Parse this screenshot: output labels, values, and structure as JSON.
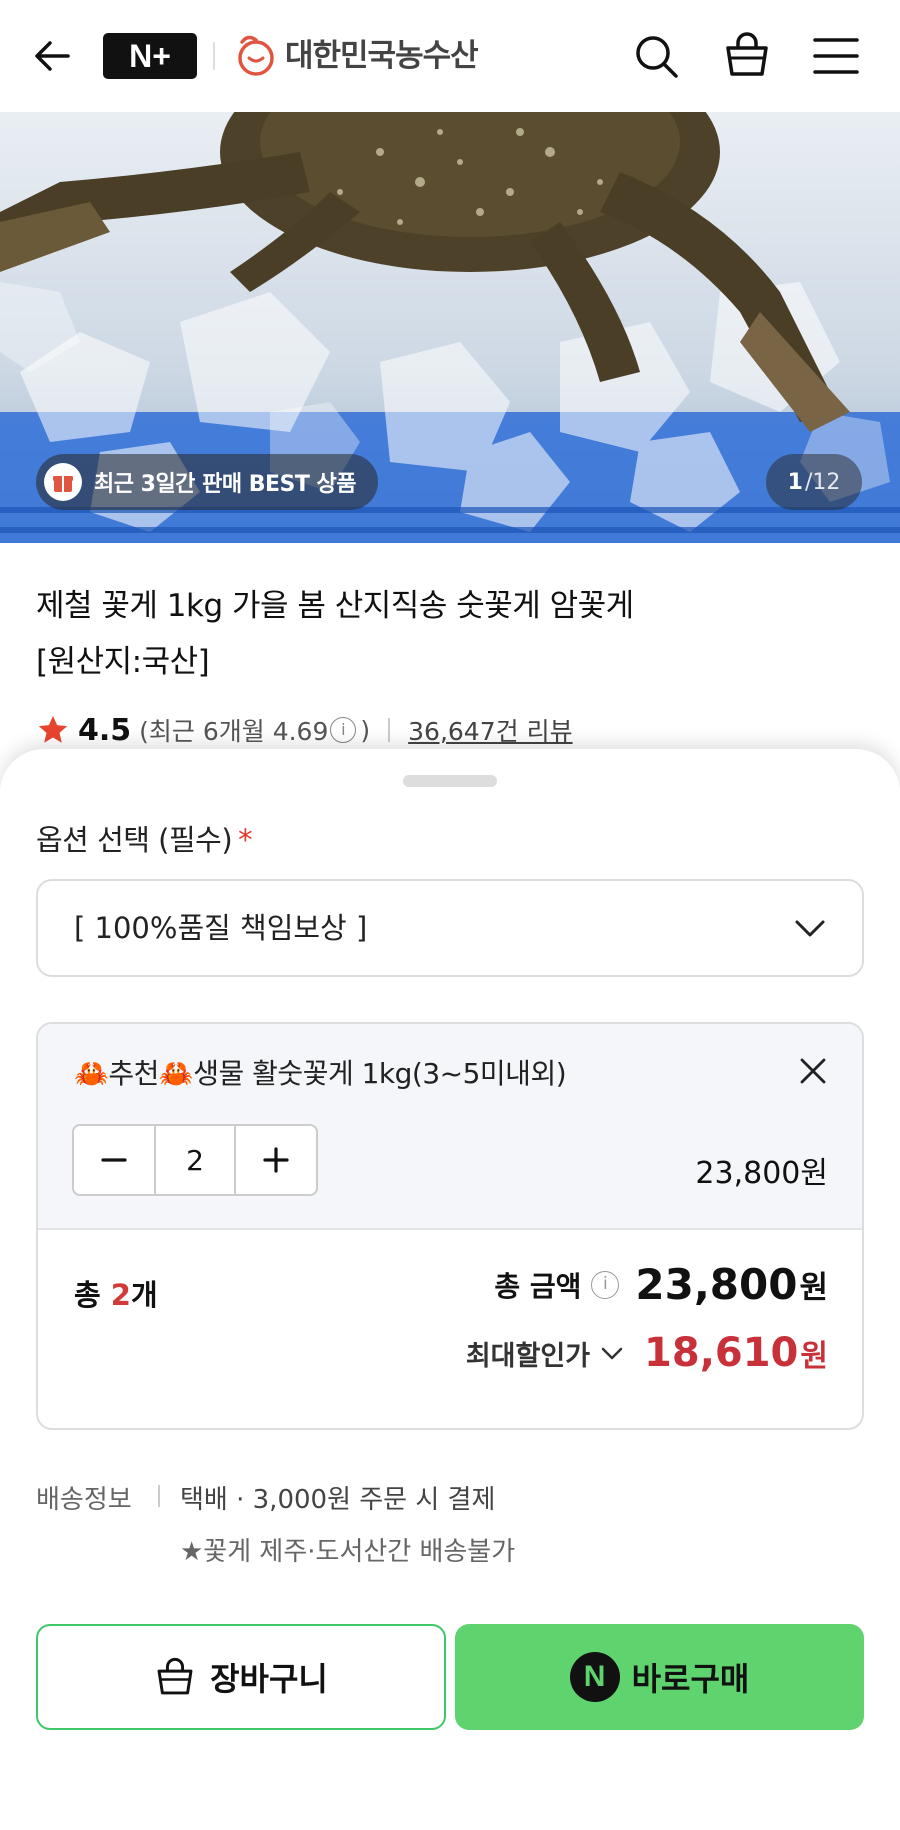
{
  "header": {
    "brand_badge": "N+",
    "store_name": "대한민국농수산"
  },
  "hero": {
    "best_badge": "최근 3일간 판매 BEST 상품",
    "page_current": "1",
    "page_total": "/12"
  },
  "product": {
    "title_line1": "제철 꽃게 1kg 가을 봄 산지직송 숫꽃게 암꽃게",
    "title_line2": "[원산지:국산]",
    "rating": "4.5",
    "recent_rating": "(최근 6개월 4.69",
    "recent_rating_close": ")",
    "info_glyph": "i",
    "reviews": "36,647건 리뷰"
  },
  "options": {
    "label": "옵션 선택 (필수)",
    "required_mark": "*",
    "selected": "[ 100%품질 책임보상 ]"
  },
  "selected_item": {
    "name": "🦀추천🦀생물 활숫꽃게 1kg(3~5미내외)",
    "quantity": "2",
    "price": "23,800원",
    "total_count_prefix": "총 ",
    "total_count_num": "2",
    "total_count_suffix": "개",
    "total_amount_label": "총 금액",
    "total_amount": "23,800",
    "total_amount_unit": "원",
    "max_discount_label": "최대할인가",
    "max_discount_amount": "18,610",
    "max_discount_unit": "원"
  },
  "shipping": {
    "label": "배송정보",
    "text": "택배 · 3,000원 주문 시 결제",
    "note": "★꽃게 제주·도서산간 배송불가"
  },
  "actions": {
    "cart_label": "장바구니",
    "buy_badge": "N",
    "buy_label": "바로구매"
  },
  "colors": {
    "accent_green": "#5ed36e",
    "price_red": "#c8303a",
    "star_red": "#e8452f"
  }
}
